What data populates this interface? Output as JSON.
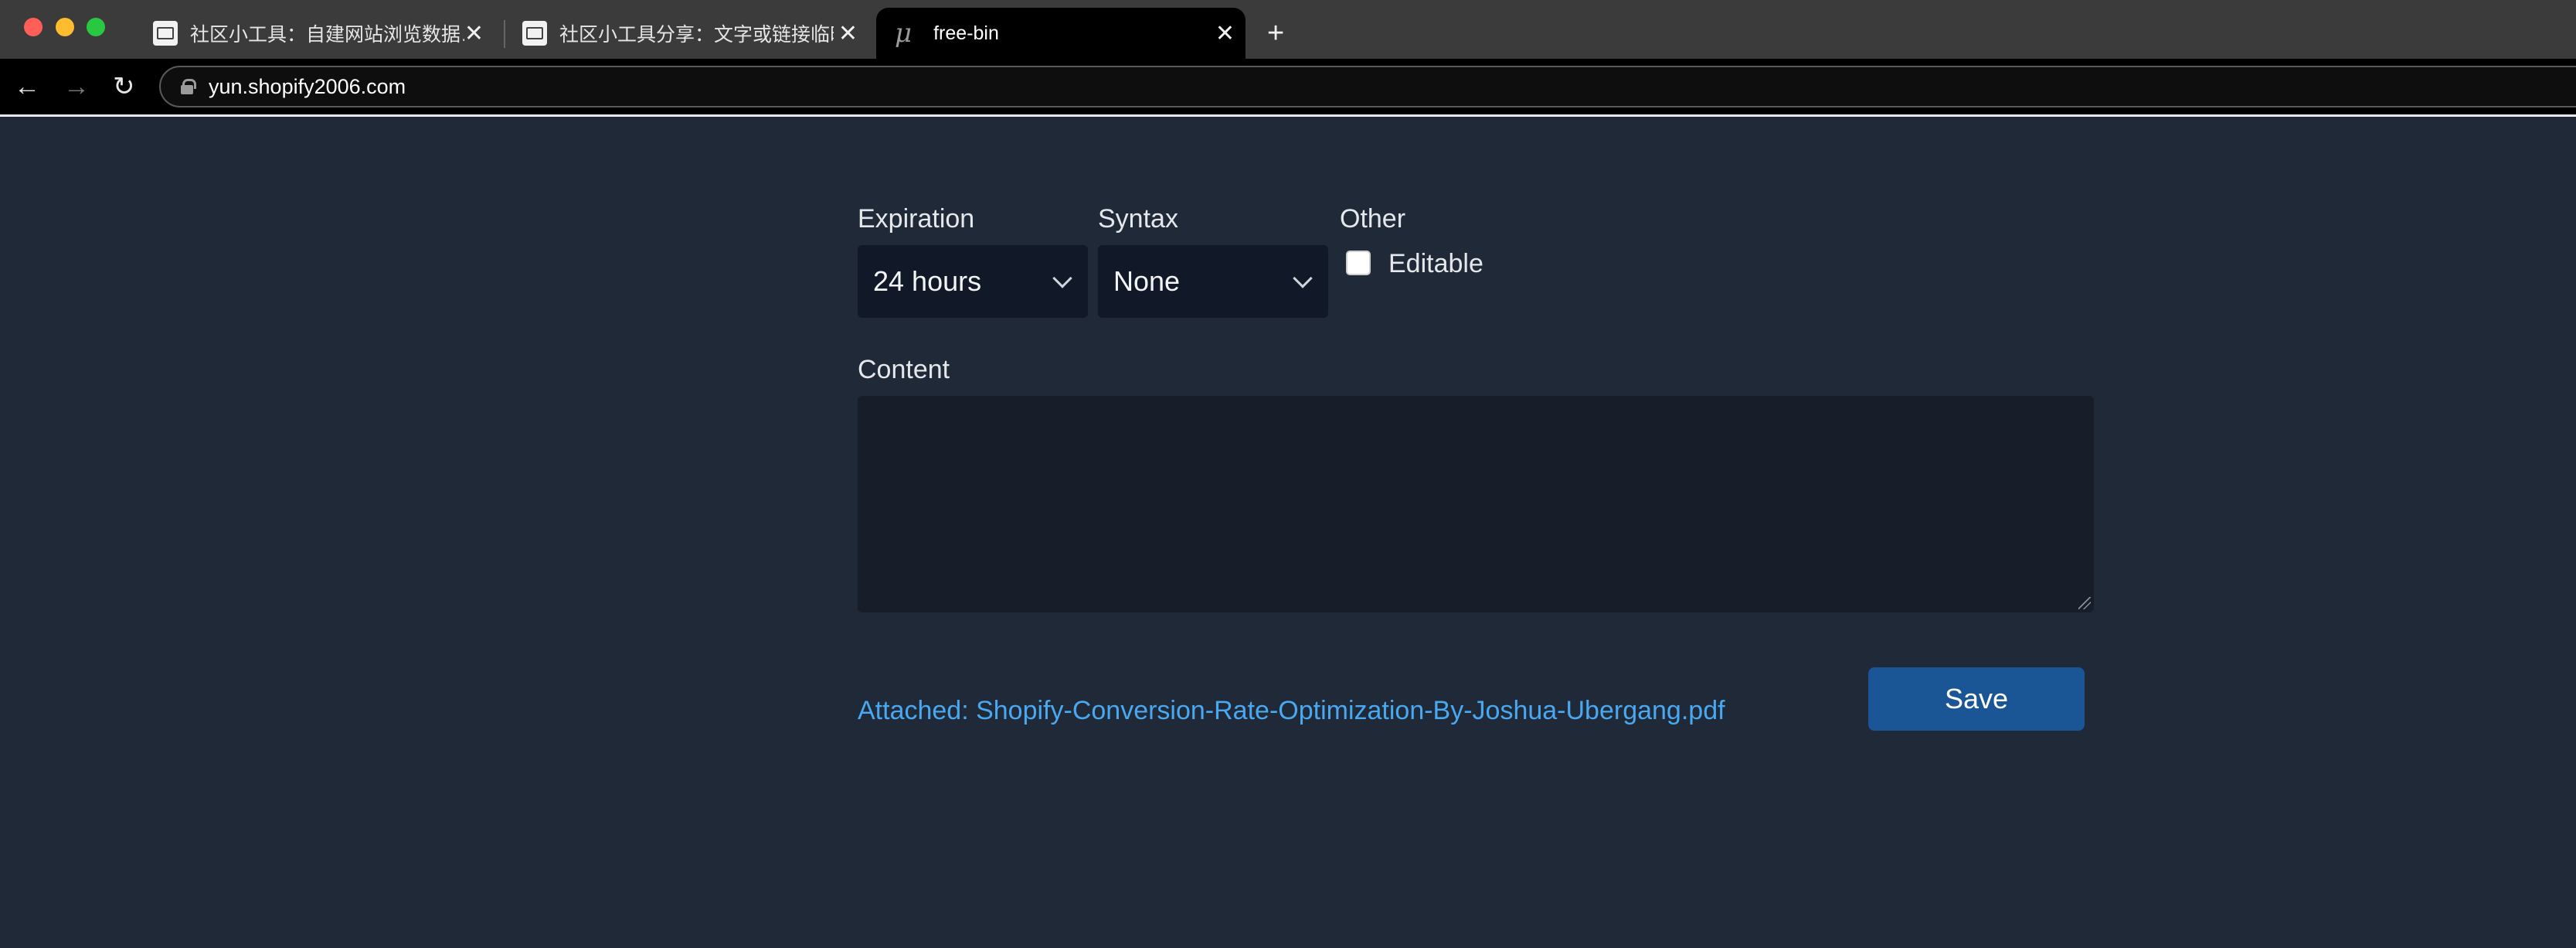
{
  "browser": {
    "tabs": [
      {
        "title": "社区小工具：自建网站浏览数据…",
        "close": "✕"
      },
      {
        "title": "社区小工具分享：文字或链接临时…",
        "close": "✕"
      },
      {
        "title": "free-bin",
        "close": "✕",
        "favicon": "μ"
      }
    ],
    "new_tab": "+",
    "nav": {
      "back": "←",
      "forward": "→",
      "reload": "↻"
    },
    "url": "yun.shopify2006.com"
  },
  "form": {
    "expiration": {
      "label": "Expiration",
      "value": "24 hours"
    },
    "syntax": {
      "label": "Syntax",
      "value": "None"
    },
    "other": {
      "label": "Other",
      "checkbox_label": "Editable",
      "checked": false
    },
    "content": {
      "label": "Content",
      "value": ""
    },
    "attached": "Attached: Shopify-Conversion-Rate-Optimization-By-Joshua-Ubergang.pdf",
    "save_label": "Save"
  },
  "colors": {
    "page_bg": "#1f2937",
    "field_bg": "#111827",
    "link": "#4aa8f0",
    "save_button": "#1a5696"
  }
}
